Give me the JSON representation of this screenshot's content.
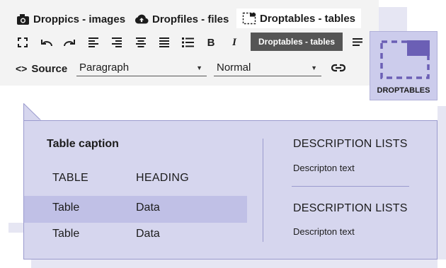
{
  "plugins": [
    {
      "label": "Droppics - images",
      "icon": "camera-icon"
    },
    {
      "label": "Dropfiles - files",
      "icon": "cloud-upload-icon"
    },
    {
      "label": "Droptables - tables",
      "icon": "table-selection-icon"
    }
  ],
  "toolbar": {
    "buttons": [
      "fullscreen-icon",
      "undo-icon",
      "redo-icon",
      "align-left-icon",
      "align-right-icon",
      "align-center-icon",
      "align-justify-icon",
      "bulleted-list-icon",
      "bold-icon",
      "italic-icon",
      "more-icon"
    ],
    "tooltip": "Droptables - tables",
    "source_label": "Source",
    "block_format": "Paragraph",
    "font_size": "Normal"
  },
  "droptables_button": {
    "label": "DROPTABLES",
    "accent": "#6b5fb5"
  },
  "preview": {
    "caption": "Table caption",
    "headers": [
      "TABLE",
      "HEADING"
    ],
    "rows": [
      [
        "Table",
        "Data"
      ],
      [
        "Table",
        "Data"
      ]
    ],
    "description_lists": [
      {
        "title": "DESCRIPTION LISTS",
        "text": "Descripton text"
      },
      {
        "title": "DESCRIPTION LISTS",
        "text": "Descripton text"
      }
    ]
  },
  "colors": {
    "panel": "#d6d6ee",
    "highlight_row": "#c0c0e6",
    "toolbar_bg": "#f3f3f3"
  }
}
